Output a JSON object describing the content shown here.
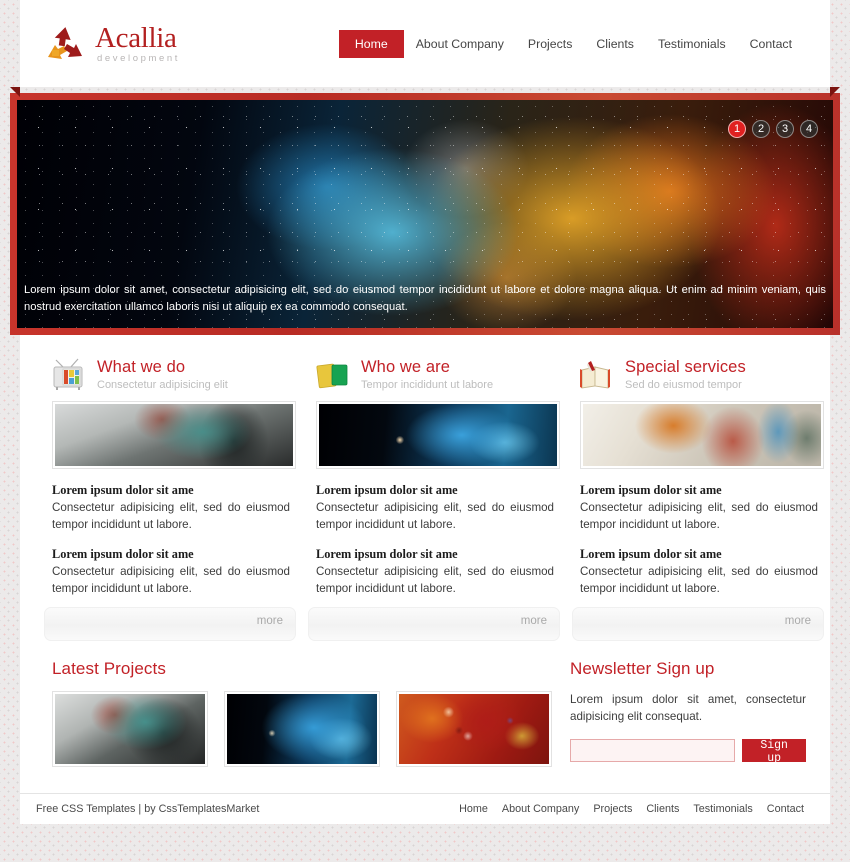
{
  "site": {
    "logo_title": "Acallia",
    "logo_sub": "development"
  },
  "nav": {
    "items": [
      {
        "label": "Home",
        "active": true
      },
      {
        "label": "About Company",
        "active": false
      },
      {
        "label": "Projects",
        "active": false
      },
      {
        "label": "Clients",
        "active": false
      },
      {
        "label": "Testimonials",
        "active": false
      },
      {
        "label": "Contact",
        "active": false
      }
    ]
  },
  "banner": {
    "caption": "Lorem ipsum dolor sit amet, consectetur adipisicing elit, sed do eiusmod tempor incididunt ut labore et dolore magna aliqua. Ut enim ad minim veniam, quis nostrud exercitation ullamco laboris nisi ut aliquip ex ea commodo consequat.",
    "pager": [
      {
        "label": "1",
        "active": true
      },
      {
        "label": "2",
        "active": false
      },
      {
        "label": "3",
        "active": false
      },
      {
        "label": "4",
        "active": false
      }
    ]
  },
  "columns": [
    {
      "icon": "television-icon",
      "title": "What we do",
      "subtitle": "Consectetur adipisicing elit",
      "more_label": "more",
      "items": [
        {
          "title": "Lorem ipsum dolor sit ame",
          "text": "Consectetur adipisicing elit, sed do eiusmod tempor incididunt ut labore."
        },
        {
          "title": "Lorem ipsum dolor sit ame",
          "text": "Consectetur adipisicing elit, sed do eiusmod tempor incididunt ut labore."
        }
      ]
    },
    {
      "icon": "cards-icon",
      "title": "Who we are",
      "subtitle": "Tempor incididunt ut labore",
      "more_label": "more",
      "items": [
        {
          "title": "Lorem ipsum dolor sit ame",
          "text": "Consectetur adipisicing elit, sed do eiusmod tempor incididunt ut labore."
        },
        {
          "title": "Lorem ipsum dolor sit ame",
          "text": "Consectetur adipisicing elit, sed do eiusmod tempor incididunt ut labore."
        }
      ]
    },
    {
      "icon": "open-book-icon",
      "title": "Special services",
      "subtitle": "Sed do eiusmod tempor",
      "more_label": "more",
      "items": [
        {
          "title": "Lorem ipsum dolor sit ame",
          "text": "Consectetur adipisicing elit, sed do eiusmod tempor incididunt ut labore."
        },
        {
          "title": "Lorem ipsum dolor sit ame",
          "text": "Consectetur adipisicing elit, sed do eiusmod tempor incididunt ut labore."
        }
      ]
    }
  ],
  "projects": {
    "title": "Latest Projects",
    "thumbs": [
      {
        "name": "project-thumbnail-1"
      },
      {
        "name": "project-thumbnail-2"
      },
      {
        "name": "project-thumbnail-3"
      }
    ]
  },
  "newsletter": {
    "title": "Newsletter Sign up",
    "text": "Lorem ipsum dolor sit amet, consectetur adipisicing elit consequat.",
    "input_value": "",
    "input_placeholder": "",
    "button_label": "Sign up"
  },
  "footer": {
    "credit": "Free CSS Templates | by CssTemplatesMarket",
    "nav": [
      {
        "label": "Home"
      },
      {
        "label": "About Company"
      },
      {
        "label": "Projects"
      },
      {
        "label": "Clients"
      },
      {
        "label": "Testimonials"
      },
      {
        "label": "Contact"
      }
    ]
  },
  "colors": {
    "accent": "#c22127",
    "banner_frame": "#c8352c",
    "muted": "#bdbdbd"
  }
}
